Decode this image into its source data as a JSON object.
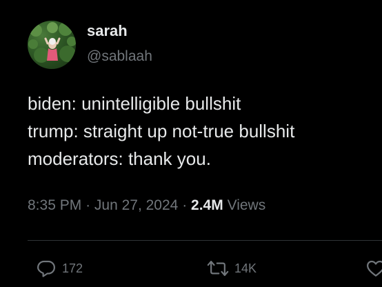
{
  "author": {
    "display_name": "sarah",
    "handle": "@sablaah"
  },
  "tweet": {
    "lines": [
      "biden: unintelligible bullshit",
      "trump: straight up not-true bullshit",
      "moderators: thank you."
    ]
  },
  "meta": {
    "time": "8:35 PM",
    "separator": "·",
    "date": "Jun 27, 2024",
    "views_count": "2.4M",
    "views_label": "Views"
  },
  "actions": {
    "reply_count": "172",
    "retweet_count": "14K"
  },
  "colors": {
    "background": "#000000",
    "text_primary": "#e7e9ea",
    "text_secondary": "#71767b",
    "divider": "#2f3336"
  },
  "icons": {
    "reply": "reply-bubble-icon",
    "retweet": "retweet-arrows-icon",
    "like": "heart-icon"
  }
}
